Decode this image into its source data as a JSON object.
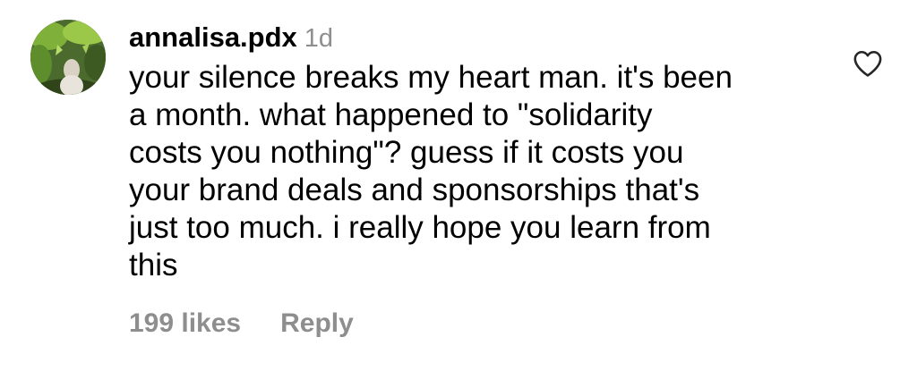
{
  "comment": {
    "username": "annalisa.pdx",
    "timestamp": "1d",
    "lines": [
      "your silence breaks my heart man. it's been",
      "a month. what happened to \"solidarity",
      "costs you nothing\"? guess if it costs you",
      "your brand deals and sponsorships that's",
      "just too much. i really hope you learn from",
      "this"
    ],
    "likes_label": "199 likes",
    "reply_label": "Reply"
  },
  "icons": {
    "like": "heart-outline-icon",
    "avatar": "profile-avatar"
  },
  "colors": {
    "text": "#000000",
    "muted": "#8e8e8e",
    "background": "#ffffff"
  }
}
